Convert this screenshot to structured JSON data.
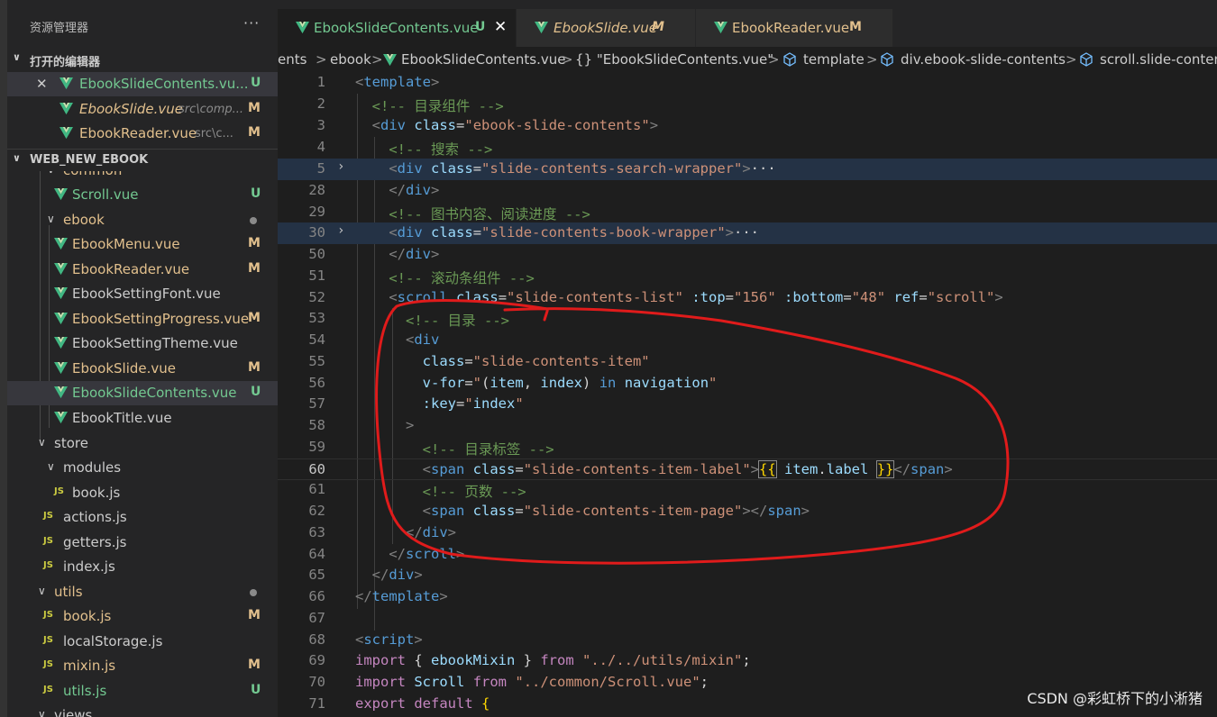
{
  "explorer": {
    "title": "资源管理器",
    "more": "···",
    "open_editors_label": "打开的编辑器",
    "project_label": "WEB_NEW_EBOOK",
    "open_editors": [
      {
        "name": "EbookSlideContents.vu...",
        "desc": "",
        "badge": "U"
      },
      {
        "name": "EbookSlide.vue",
        "desc": "src\\comp...",
        "badge": "M"
      },
      {
        "name": "EbookReader.vue",
        "desc": "src\\c...",
        "badge": "M"
      }
    ],
    "tree": {
      "common": "common",
      "scroll": {
        "name": "Scroll.vue",
        "badge": "U"
      },
      "ebook_folder": "ebook",
      "ebook_files": [
        {
          "name": "EbookMenu.vue",
          "badge": "M"
        },
        {
          "name": "EbookReader.vue",
          "badge": "M"
        },
        {
          "name": "EbookSettingFont.vue",
          "badge": ""
        },
        {
          "name": "EbookSettingProgress.vue",
          "badge": "M"
        },
        {
          "name": "EbookSettingTheme.vue",
          "badge": ""
        },
        {
          "name": "EbookSlide.vue",
          "badge": "M"
        },
        {
          "name": "EbookSlideContents.vue",
          "badge": "U"
        },
        {
          "name": "EbookTitle.vue",
          "badge": ""
        }
      ],
      "store_folder": "store",
      "modules_folder": "modules",
      "book_js_module": "book.js",
      "store_files": [
        "actions.js",
        "getters.js",
        "index.js"
      ],
      "utils_folder": "utils",
      "utils_files": [
        {
          "name": "book.js",
          "badge": "M"
        },
        {
          "name": "localStorage.js",
          "badge": ""
        },
        {
          "name": "mixin.js",
          "badge": "M"
        },
        {
          "name": "utils.js",
          "badge": "U"
        }
      ],
      "views_folder": "views",
      "js_icon": "JS"
    }
  },
  "tabs": [
    {
      "name": "EbookSlideContents.vue",
      "badge": "U",
      "close": "✕"
    },
    {
      "name": "EbookSlide.vue",
      "badge": "M"
    },
    {
      "name": "EbookReader.vue",
      "badge": "M"
    }
  ],
  "breadcrumb": {
    "items": [
      "ents",
      "ebook",
      "EbookSlideContents.vue",
      "{} \"EbookSlideContents.vue\"",
      "template",
      "div.ebook-slide-contents",
      "scroll.slide-conten"
    ],
    "sep": ">"
  },
  "editor": {
    "line_numbers": [
      "1",
      "2",
      "3",
      "4",
      "5",
      "28",
      "29",
      "30",
      "50",
      "51",
      "52",
      "53",
      "54",
      "55",
      "56",
      "57",
      "58",
      "59",
      "60",
      "61",
      "62",
      "63",
      "64",
      "65",
      "66",
      "67",
      "68",
      "69",
      "70",
      "71"
    ],
    "fold_marker": "›"
  },
  "colors": {
    "accent_green": "#73c991",
    "modified": "#e2c08d",
    "annotation": "#e01b1b",
    "vue_icon": "#41b883"
  },
  "watermark": "CSDN @彩虹桥下的小淅猪"
}
